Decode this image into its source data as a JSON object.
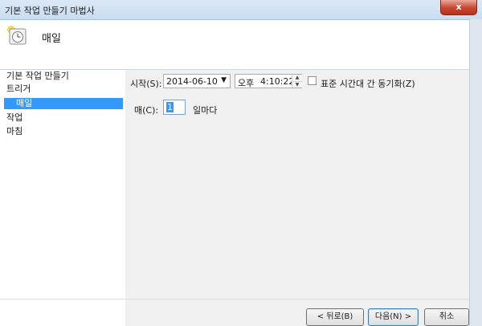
{
  "window": {
    "title": "기본 작업 만들기 마법사",
    "close_label": "x"
  },
  "header": {
    "title": "매일",
    "icon": "clock-icon"
  },
  "nav": {
    "items": [
      {
        "label": "기본 작업 만들기"
      },
      {
        "label": "트리거"
      },
      {
        "label": "매일",
        "selected": true
      },
      {
        "label": "작업"
      },
      {
        "label": "마침"
      }
    ]
  },
  "trigger": {
    "start_label": "시작(S):",
    "start_date": "2014-06-10",
    "ampm": "오후",
    "start_time": "4:10:22",
    "sync_label": "표준 시간대 간 동기화(Z)",
    "sync_checked": false,
    "recur_label": "매(C):",
    "recur_value": "1",
    "recur_unit": "일마다"
  },
  "footer": {
    "back_label": "< 뒤로(B)",
    "next_label": "다음(N) >",
    "cancel_label": "취소"
  },
  "colors": {
    "selection": "#3399ff",
    "close": "#c9452f"
  }
}
